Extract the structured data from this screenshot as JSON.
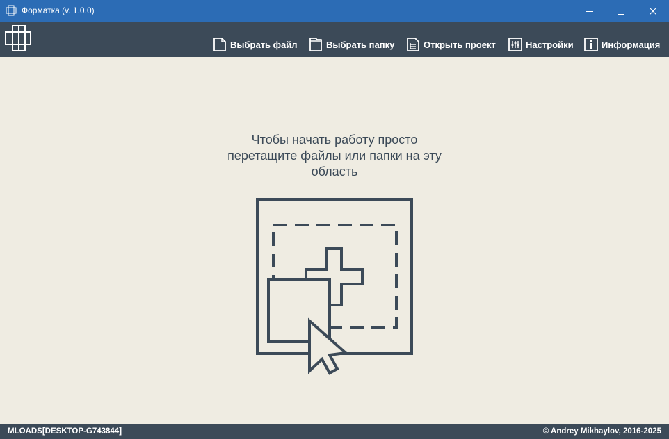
{
  "window": {
    "title": "Форматка (v. 1.0.0)"
  },
  "toolbar": {
    "select_file": "Выбрать файл",
    "select_folder": "Выбрать папку",
    "open_project": "Открыть проект",
    "settings": "Настройки",
    "info": "Информация"
  },
  "drop_area": {
    "line1": "Чтобы начать работу просто",
    "line2": "перетащите файлы или папки на эту",
    "line3": "область"
  },
  "status": {
    "left": "MLOADS[DESKTOP-G743844]",
    "right": "© Andrey Mikhaylov, 2016-2025"
  },
  "colors": {
    "titlebar": "#2c6cb5",
    "toolbar": "#3c4a58",
    "background": "#efece2",
    "accent": "#3c4a58"
  }
}
